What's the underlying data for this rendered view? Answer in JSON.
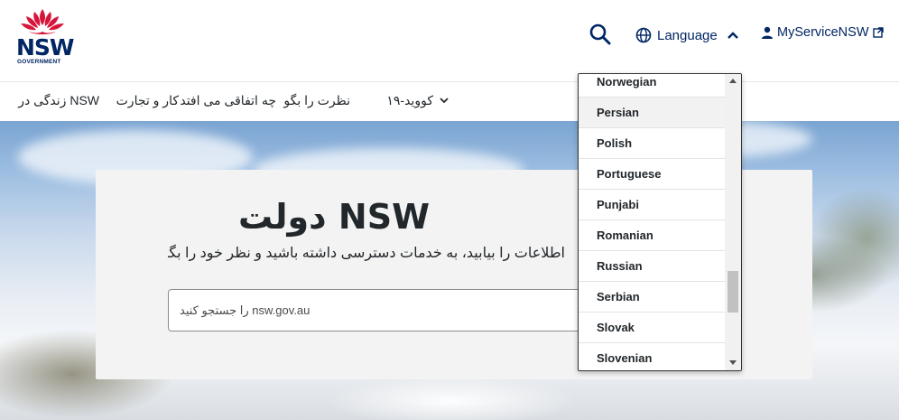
{
  "header": {
    "logo": {
      "wordmark": "NSW",
      "subtext": "GOVERNMENT",
      "icon": "waratah-logo-icon",
      "accent_color": "#d7153a",
      "brand_color": "#002664"
    },
    "search_icon": "search-icon",
    "language_label": "Language",
    "language_icon": "globe-icon",
    "language_chevron": "chevron-up-icon",
    "myservice_label": "MyServiceNSW",
    "myservice_icon": "user-icon",
    "myservice_ext_icon": "external-link-icon"
  },
  "nav": {
    "items": [
      "NSW زندگی در",
      "کار و تجارت",
      "چه اتفاقی می افتد",
      "نظرت را بگو",
      "کووید-١٩"
    ],
    "chevron_icon": "chevron-down-icon"
  },
  "hero": {
    "title": "NSW دولت",
    "subtitle": "اطلاعات را بیابید، به خدمات دسترسی داشته باشید و نظر خود را بگویید",
    "search_placeholder": "nsw.gov.au را جستجو کنید"
  },
  "language_dropdown": {
    "options": [
      "Norwegian",
      "Persian",
      "Polish",
      "Portuguese",
      "Punjabi",
      "Romanian",
      "Russian",
      "Serbian",
      "Slovak",
      "Slovenian"
    ],
    "highlighted": "Persian",
    "scroll_up_icon": "scroll-up-arrow-icon",
    "scroll_down_icon": "scroll-down-arrow-icon"
  }
}
